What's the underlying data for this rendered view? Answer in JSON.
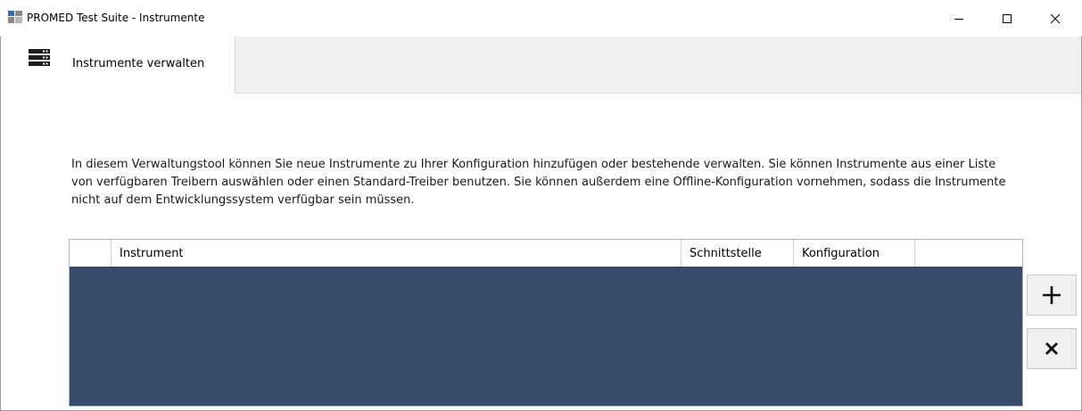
{
  "window": {
    "title": "PROMED Test Suite - Instrumente"
  },
  "tabs": [
    {
      "label": "Instrumente verwalten",
      "icon": "server-rack-icon",
      "active": true
    }
  ],
  "description": "In diesem Verwaltungstool können Sie neue Instrumente zu Ihrer Konfiguration hinzufügen oder bestehende verwalten. Sie können Instrumente aus einer Liste von verfügbaren Treibern auswählen oder einen Standard-Treiber benutzen. Sie können außerdem eine Offline-Konfiguration vornehmen, sodass die Instrumente nicht auf dem Entwicklungssystem verfügbar sein müssen.",
  "table": {
    "columns": [
      "",
      "Instrument",
      "Schnittstelle",
      "Konfiguration",
      ""
    ],
    "rows": []
  },
  "actions": {
    "add_icon": "plus-icon",
    "remove_icon": "x-icon"
  },
  "colors": {
    "table_background": "#364a6a",
    "tab_strip": "#f0f0f0"
  }
}
